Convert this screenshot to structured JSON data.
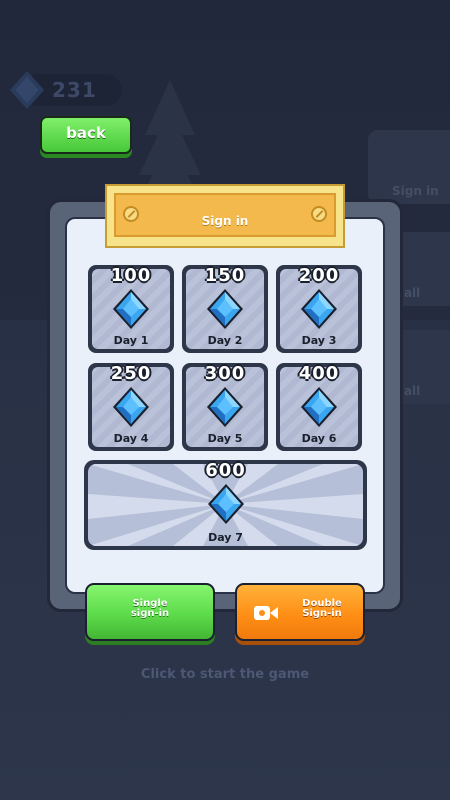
{
  "hud": {
    "gem_count": "231",
    "back_label": "back"
  },
  "background": {
    "side_labels": [
      "Sign in",
      "Mall",
      "Mall"
    ]
  },
  "dialog": {
    "title": "Sign in"
  },
  "days": [
    {
      "amount": "100",
      "label": "Day 1"
    },
    {
      "amount": "150",
      "label": "Day 2"
    },
    {
      "amount": "200",
      "label": "Day 3"
    },
    {
      "amount": "250",
      "label": "Day 4"
    },
    {
      "amount": "300",
      "label": "Day 5"
    },
    {
      "amount": "400",
      "label": "Day 6"
    },
    {
      "amount": "600",
      "label": "Day 7"
    }
  ],
  "buttons": {
    "single_line1": "Single",
    "single_line2": "sign-in",
    "double_line1": "Double",
    "double_line2": "Sign-in"
  },
  "hint": "Click to start the game",
  "icons": {
    "currency": "blue-gem-icon",
    "video": "video-camera-icon"
  },
  "colors": {
    "green": "#5ddb4a",
    "orange": "#ff8f16",
    "title_board": "#f3b94c",
    "gem": "#3aa6f0"
  }
}
